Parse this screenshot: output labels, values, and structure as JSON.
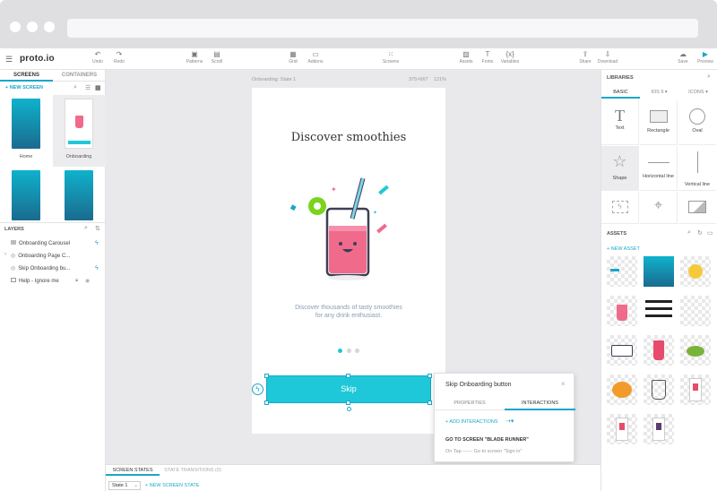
{
  "app": {
    "logo": "proto.io"
  },
  "toolbar": {
    "undo": "Undo",
    "redo": "Redo",
    "patterns": "Patterns",
    "scroll": "Scroll",
    "grid": "Grid",
    "addons": "Addons",
    "screens": "Screens",
    "assets": "Assets",
    "fonts": "Fonts",
    "variables": "Variables",
    "share": "Share",
    "download": "Download",
    "save": "Save",
    "preview": "Preview"
  },
  "left": {
    "tab_screens": "SCREENS",
    "tab_containers": "CONTAINERS",
    "new_screen": "+ NEW SCREEN",
    "screens": [
      {
        "label": "Home"
      },
      {
        "label": "Onboarding"
      },
      {
        "label": ""
      },
      {
        "label": ""
      }
    ],
    "layers_title": "LAYERS",
    "layers": [
      {
        "label": "Onboarding Carousel"
      },
      {
        "label": "Onboarding Page C..."
      },
      {
        "label": "Skip Onboarding bu..."
      },
      {
        "label": "Help - Ignore me"
      }
    ]
  },
  "canvas": {
    "screen_name": "Onboarding: State 1",
    "dims": "375×667",
    "zoom": "121%",
    "headline": "Discover smoothies",
    "body_line1": "Discover thousands of tasty smoothies",
    "body_line2": "for any drink enthusiast.",
    "skip_label": "Skip"
  },
  "bottom": {
    "tab_states": "SCREEN STATES",
    "tab_transitions": "STATE TRANSITIONS (0)",
    "state_value": "State 1",
    "new_state": "+ NEW SCREEN STATE"
  },
  "popup": {
    "title": "Skip Onboarding button",
    "tab_properties": "PROPERTIES",
    "tab_interactions": "INTERACTIONS",
    "add_interactions": "+ ADD INTERACTIONS",
    "goto": "GO TO SCREEN \"BLADE RUNNER\"",
    "detail": "On Tap ------ Go to screen \"Sign in\""
  },
  "right": {
    "libraries": "LIBRARIES",
    "tab_basic": "BASIC",
    "tab_ios": "IOS 9",
    "tab_icons": "ICONS",
    "items": [
      {
        "label": "Text"
      },
      {
        "label": "Rectangle"
      },
      {
        "label": "Oval"
      },
      {
        "label": "Shape"
      },
      {
        "label": "Horizontal line"
      },
      {
        "label": "Vertical line"
      }
    ],
    "assets_title": "ASSETS",
    "new_asset": "+ NEW ASSET"
  },
  "colors": {
    "accent": "#1ec8d8",
    "teal": "#1aa6c9"
  }
}
